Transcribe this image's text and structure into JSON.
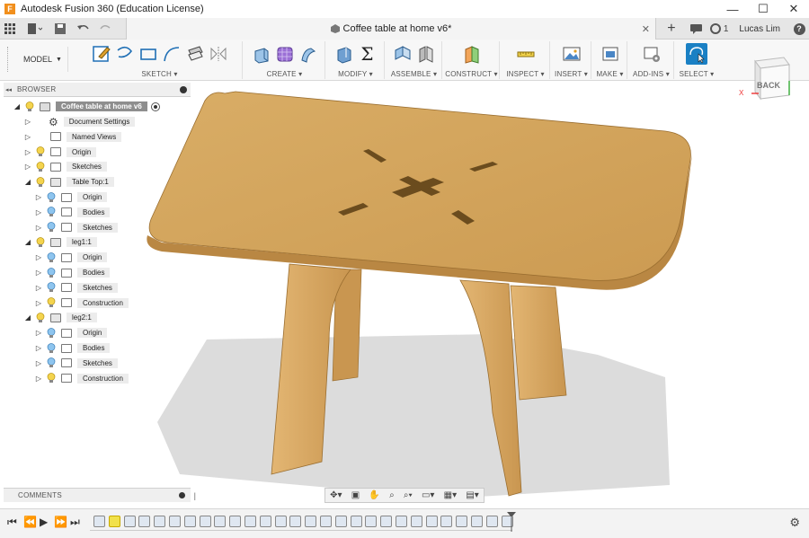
{
  "window": {
    "title": "Autodesk Fusion 360 (Education License)",
    "logo_letter": "F",
    "controls": [
      "—",
      "☐",
      "✕"
    ]
  },
  "tabbar": {
    "document_title": "Coffee table at home v6*",
    "job_count": "1",
    "user": "Lucas Lim",
    "help": "?"
  },
  "toolbar": {
    "workspace": "MODEL",
    "groups": [
      {
        "label": "SKETCH ▾"
      },
      {
        "label": "CREATE ▾"
      },
      {
        "label": "MODIFY ▾"
      },
      {
        "label": "ASSEMBLE ▾"
      },
      {
        "label": "CONSTRUCT ▾"
      },
      {
        "label": "INSPECT ▾"
      },
      {
        "label": "INSERT ▾"
      },
      {
        "label": "MAKE ▾"
      },
      {
        "label": "ADD-INS ▾"
      },
      {
        "label": "SELECT ▾"
      }
    ]
  },
  "viewcube": {
    "face": "BACK",
    "axis_x": "X"
  },
  "browser": {
    "title": "BROWSER",
    "root": "Coffee table at home v6",
    "items": [
      {
        "label": "Document Settings"
      },
      {
        "label": "Named Views"
      },
      {
        "label": "Origin"
      },
      {
        "label": "Sketches"
      },
      {
        "label": "Table Top:1"
      },
      {
        "label": "Origin"
      },
      {
        "label": "Bodies"
      },
      {
        "label": "Sketches"
      },
      {
        "label": "leg1:1"
      },
      {
        "label": "Origin"
      },
      {
        "label": "Bodies"
      },
      {
        "label": "Sketches"
      },
      {
        "label": "Construction"
      },
      {
        "label": "leg2:1"
      },
      {
        "label": "Origin"
      },
      {
        "label": "Bodies"
      },
      {
        "label": "Sketches"
      },
      {
        "label": "Construction"
      }
    ]
  },
  "comments": {
    "title": "COMMENTS"
  },
  "navbar": {
    "icons": [
      "orbit-icon",
      "look-at-icon",
      "pan-icon",
      "zoom-fit-icon",
      "zoom-icon",
      "display-settings-icon",
      "grid-icon",
      "viewports-icon"
    ]
  },
  "colors": {
    "accent_select": "#1a80c4",
    "wood": "#d5a35c",
    "wood_edge": "#b88540",
    "timeline_selected": "#f1e14b"
  }
}
